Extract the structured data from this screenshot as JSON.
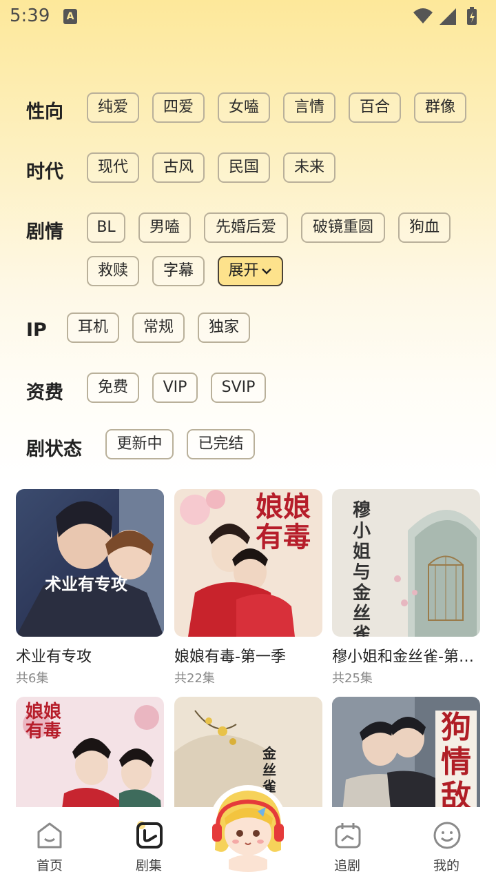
{
  "status_bar": {
    "time": "5:39",
    "notif_letter": "A"
  },
  "filters": {
    "orientation": {
      "label": "性向",
      "options": [
        "纯爱",
        "四爱",
        "女嗑",
        "言情",
        "百合",
        "群像"
      ]
    },
    "era": {
      "label": "时代",
      "options": [
        "现代",
        "古风",
        "民国",
        "未来"
      ]
    },
    "plot": {
      "label": "剧情",
      "options": [
        "BL",
        "男嗑",
        "先婚后爱",
        "破镜重圆",
        "狗血",
        "救赎",
        "字幕"
      ],
      "expand_label": "展开"
    },
    "ip": {
      "label": "IP",
      "options": [
        "耳机",
        "常规",
        "独家"
      ]
    },
    "fee": {
      "label": "资费",
      "options": [
        "免费",
        "VIP",
        "SVIP"
      ]
    },
    "status": {
      "label": "剧状态",
      "options": [
        "更新中",
        "已完结"
      ]
    }
  },
  "dramas": [
    {
      "title": "术业有专攻",
      "count": "共6集",
      "cover_text": "术业有专攻"
    },
    {
      "title": "娘娘有毒-第一季",
      "count": "共22集",
      "cover_text": "娘娘有毒"
    },
    {
      "title": "穆小姐和金丝雀-第一季",
      "count": "共25集",
      "cover_text": "穆小姐与金丝雀"
    },
    {
      "title": "",
      "count": "",
      "cover_text": "娘娘有毒"
    },
    {
      "title": "",
      "count": "",
      "cover_text": "金丝雀"
    },
    {
      "title": "",
      "count": "",
      "cover_text": "狗情敌"
    }
  ],
  "nav": {
    "items": [
      {
        "label": "首页",
        "icon": "home-icon"
      },
      {
        "label": "剧集",
        "icon": "drama-list-icon"
      },
      {
        "label": "追剧",
        "icon": "follow-calendar-icon"
      },
      {
        "label": "我的",
        "icon": "profile-smile-icon"
      }
    ]
  },
  "colors": {
    "accent": "#fde28c",
    "chip_border": "#b9b09a",
    "header_bg": "#fde89a"
  }
}
